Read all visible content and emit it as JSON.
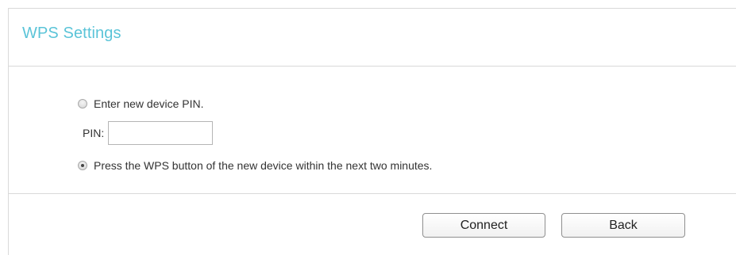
{
  "header": {
    "title": "WPS Settings"
  },
  "options": {
    "enter_pin_label": "Enter new device PIN.",
    "pin_label": "PIN:",
    "pin_value": "",
    "press_button_label": "Press the WPS button of the new device within the next two minutes.",
    "selected": "press_button"
  },
  "actions": {
    "connect_label": "Connect",
    "back_label": "Back"
  },
  "colors": {
    "title": "#5bc4d8",
    "divider": "#d9d9d9"
  }
}
